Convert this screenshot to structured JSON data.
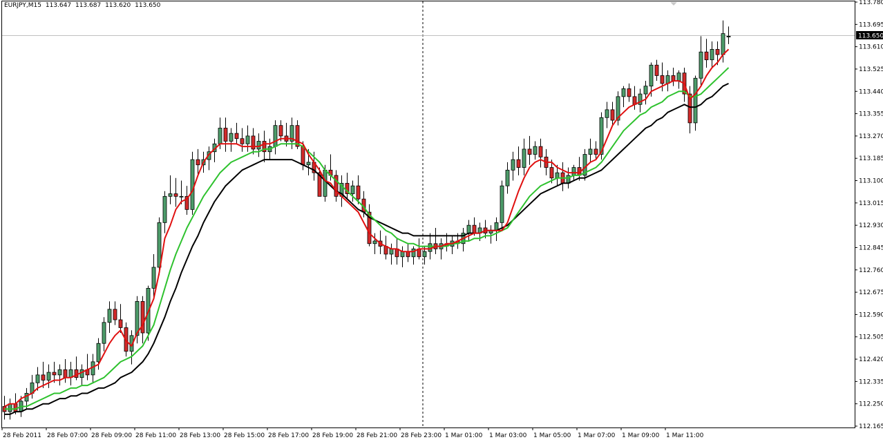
{
  "header": {
    "symbol": "EURJPY,M15",
    "open": "113.647",
    "high": "113.687",
    "low": "113.620",
    "close": "113.650"
  },
  "current_price_label": "113.650",
  "colors": {
    "background": "#ffffff",
    "frame": "#000000",
    "bull_body": "#4d9c6a",
    "bear_body": "#d22a2a",
    "wick": "#000000",
    "ma_fast": "#e01010",
    "ma_mid": "#2ec22e",
    "ma_slow": "#000000",
    "price_line": "#c0c0c0",
    "price_tag_bg": "#000000",
    "price_tag_text": "#ffffff"
  },
  "chart_data": {
    "type": "candlestick",
    "symbol": "EURJPY",
    "timeframe": "M15",
    "ylim": [
      112.165,
      113.78
    ],
    "y_tick_labels": [
      "113.780",
      "113.695",
      "113.610",
      "113.525",
      "113.440",
      "113.355",
      "113.270",
      "113.185",
      "113.100",
      "113.015",
      "112.930",
      "112.845",
      "112.760",
      "112.675",
      "112.590",
      "112.505",
      "112.420",
      "112.335",
      "112.250",
      "112.165"
    ],
    "x_tick_labels": [
      "28 Feb 2011",
      "28 Feb 07:00",
      "28 Feb 09:00",
      "28 Feb 11:00",
      "28 Feb 13:00",
      "28 Feb 15:00",
      "28 Feb 17:00",
      "28 Feb 19:00",
      "28 Feb 21:00",
      "28 Feb 23:00",
      "1 Mar 01:00",
      "1 Mar 03:00",
      "1 Mar 05:00",
      "1 Mar 07:00",
      "1 Mar 09:00",
      "1 Mar 11:00"
    ],
    "bars_per_label": 8,
    "vertical_marker_after_label": "28 Feb 23:00",
    "candles": [
      [
        112.24,
        112.28,
        112.19,
        112.22
      ],
      [
        112.22,
        112.27,
        112.19,
        112.25
      ],
      [
        112.25,
        112.29,
        112.21,
        112.22
      ],
      [
        112.22,
        112.28,
        112.2,
        112.26
      ],
      [
        112.26,
        112.31,
        112.23,
        112.29
      ],
      [
        112.29,
        112.36,
        112.27,
        112.33
      ],
      [
        112.33,
        112.39,
        112.3,
        112.36
      ],
      [
        112.36,
        112.41,
        112.31,
        112.34
      ],
      [
        112.34,
        112.4,
        112.31,
        112.37
      ],
      [
        112.37,
        112.41,
        112.33,
        112.36
      ],
      [
        112.36,
        112.4,
        112.32,
        112.38
      ],
      [
        112.38,
        112.42,
        112.33,
        112.35
      ],
      [
        112.35,
        112.41,
        112.32,
        112.38
      ],
      [
        112.38,
        112.43,
        112.34,
        112.35
      ],
      [
        112.35,
        112.4,
        112.32,
        112.38
      ],
      [
        112.38,
        112.44,
        112.34,
        112.36
      ],
      [
        112.36,
        112.44,
        112.33,
        112.41
      ],
      [
        112.41,
        112.5,
        112.38,
        112.48
      ],
      [
        112.48,
        112.58,
        112.45,
        112.56
      ],
      [
        112.56,
        112.64,
        112.52,
        112.61
      ],
      [
        112.61,
        112.64,
        112.55,
        112.57
      ],
      [
        112.57,
        112.63,
        112.52,
        112.54
      ],
      [
        112.54,
        112.56,
        112.43,
        112.45
      ],
      [
        112.45,
        112.53,
        112.4,
        112.51
      ],
      [
        112.51,
        112.66,
        112.48,
        112.64
      ],
      [
        112.64,
        112.66,
        112.48,
        112.52
      ],
      [
        112.52,
        112.7,
        112.49,
        112.69
      ],
      [
        112.69,
        112.82,
        112.65,
        112.77
      ],
      [
        112.77,
        112.96,
        112.74,
        112.94
      ],
      [
        112.94,
        113.06,
        112.9,
        113.04
      ],
      [
        113.04,
        113.12,
        113.01,
        113.05
      ],
      [
        113.05,
        113.11,
        113.0,
        113.04
      ],
      [
        113.04,
        113.1,
        113.01,
        113.04
      ],
      [
        113.04,
        113.08,
        112.97,
        112.99
      ],
      [
        112.99,
        113.21,
        112.97,
        113.18
      ],
      [
        113.18,
        113.22,
        113.12,
        113.16
      ],
      [
        113.16,
        113.21,
        113.13,
        113.18
      ],
      [
        113.18,
        113.23,
        113.14,
        113.21
      ],
      [
        113.21,
        113.26,
        113.17,
        113.24
      ],
      [
        113.24,
        113.34,
        113.22,
        113.3
      ],
      [
        113.3,
        113.34,
        113.21,
        113.25
      ],
      [
        113.25,
        113.3,
        113.21,
        113.28
      ],
      [
        113.28,
        113.32,
        113.24,
        113.26
      ],
      [
        113.26,
        113.3,
        113.21,
        113.24
      ],
      [
        113.24,
        113.31,
        113.21,
        113.27
      ],
      [
        113.27,
        113.3,
        113.2,
        113.22
      ],
      [
        113.22,
        113.28,
        113.19,
        113.25
      ],
      [
        113.25,
        113.29,
        113.17,
        113.21
      ],
      [
        113.21,
        113.26,
        113.18,
        113.23
      ],
      [
        113.23,
        113.33,
        113.2,
        113.31
      ],
      [
        113.31,
        113.33,
        113.25,
        113.27
      ],
      [
        113.27,
        113.32,
        113.23,
        113.25
      ],
      [
        113.25,
        113.34,
        113.22,
        113.31
      ],
      [
        113.31,
        113.33,
        113.22,
        113.23
      ],
      [
        113.23,
        113.25,
        113.14,
        113.16
      ],
      [
        113.16,
        113.22,
        113.12,
        113.17
      ],
      [
        113.17,
        113.21,
        113.1,
        113.13
      ],
      [
        113.13,
        113.15,
        113.04,
        113.04
      ],
      [
        113.04,
        113.16,
        113.02,
        113.14
      ],
      [
        113.14,
        113.2,
        113.1,
        113.12
      ],
      [
        113.12,
        113.14,
        113.02,
        113.04
      ],
      [
        113.04,
        113.12,
        113.0,
        113.09
      ],
      [
        113.09,
        113.13,
        113.03,
        113.05
      ],
      [
        113.05,
        113.1,
        113.02,
        113.08
      ],
      [
        113.08,
        113.12,
        113.01,
        113.03
      ],
      [
        113.03,
        113.06,
        112.96,
        112.98
      ],
      [
        112.98,
        113.01,
        112.85,
        112.86
      ],
      [
        112.86,
        112.9,
        112.82,
        112.87
      ],
      [
        112.87,
        112.91,
        112.82,
        112.85
      ],
      [
        112.85,
        112.89,
        112.8,
        112.82
      ],
      [
        112.82,
        112.86,
        112.78,
        112.84
      ],
      [
        112.84,
        112.88,
        112.78,
        112.81
      ],
      [
        112.81,
        112.85,
        112.77,
        112.83
      ],
      [
        112.83,
        112.86,
        112.79,
        112.81
      ],
      [
        112.81,
        112.85,
        112.78,
        112.84
      ],
      [
        112.84,
        112.88,
        112.8,
        112.81
      ],
      [
        112.81,
        112.85,
        112.78,
        112.83
      ],
      [
        112.83,
        112.9,
        112.8,
        112.86
      ],
      [
        112.86,
        112.92,
        112.82,
        112.84
      ],
      [
        112.84,
        112.88,
        112.8,
        112.86
      ],
      [
        112.86,
        112.9,
        112.83,
        112.85
      ],
      [
        112.85,
        112.89,
        112.82,
        112.87
      ],
      [
        112.87,
        112.9,
        112.84,
        112.86
      ],
      [
        112.86,
        112.92,
        112.83,
        112.9
      ],
      [
        112.9,
        112.95,
        112.87,
        112.93
      ],
      [
        112.93,
        112.96,
        112.89,
        112.9
      ],
      [
        112.9,
        112.94,
        112.87,
        112.92
      ],
      [
        112.92,
        112.95,
        112.88,
        112.9
      ],
      [
        112.9,
        112.93,
        112.86,
        112.91
      ],
      [
        112.91,
        112.96,
        112.87,
        112.94
      ],
      [
        112.94,
        113.1,
        112.91,
        113.08
      ],
      [
        113.08,
        113.17,
        113.05,
        113.14
      ],
      [
        113.14,
        113.21,
        113.1,
        113.18
      ],
      [
        113.18,
        113.23,
        113.12,
        113.15
      ],
      [
        113.15,
        113.26,
        113.12,
        113.22
      ],
      [
        113.22,
        113.27,
        113.16,
        113.2
      ],
      [
        113.2,
        113.25,
        113.18,
        113.23
      ],
      [
        113.23,
        113.26,
        113.15,
        113.19
      ],
      [
        113.19,
        113.22,
        113.12,
        113.15
      ],
      [
        113.15,
        113.18,
        113.09,
        113.11
      ],
      [
        113.11,
        113.16,
        113.08,
        113.13
      ],
      [
        113.13,
        113.17,
        113.06,
        113.09
      ],
      [
        113.09,
        113.15,
        113.07,
        113.12
      ],
      [
        113.12,
        113.16,
        113.1,
        113.15
      ],
      [
        113.15,
        113.19,
        113.1,
        113.12
      ],
      [
        113.12,
        113.22,
        113.1,
        113.2
      ],
      [
        113.2,
        113.26,
        113.17,
        113.22
      ],
      [
        113.22,
        113.25,
        113.18,
        113.2
      ],
      [
        113.2,
        113.36,
        113.18,
        113.34
      ],
      [
        113.34,
        113.4,
        113.3,
        113.37
      ],
      [
        113.37,
        113.4,
        113.31,
        113.33
      ],
      [
        113.33,
        113.44,
        113.31,
        113.42
      ],
      [
        113.42,
        113.46,
        113.38,
        113.45
      ],
      [
        113.45,
        113.47,
        113.4,
        113.42
      ],
      [
        113.42,
        113.46,
        113.37,
        113.39
      ],
      [
        113.39,
        113.45,
        113.36,
        113.43
      ],
      [
        113.43,
        113.48,
        113.39,
        113.46
      ],
      [
        113.46,
        113.55,
        113.42,
        113.54
      ],
      [
        113.54,
        113.56,
        113.48,
        113.5
      ],
      [
        113.5,
        113.55,
        113.44,
        113.47
      ],
      [
        113.47,
        113.52,
        113.44,
        113.5
      ],
      [
        113.5,
        113.53,
        113.46,
        113.48
      ],
      [
        113.48,
        113.52,
        113.45,
        113.51
      ],
      [
        113.51,
        113.53,
        113.4,
        113.43
      ],
      [
        113.43,
        113.46,
        113.28,
        113.32
      ],
      [
        113.32,
        113.5,
        113.29,
        113.49
      ],
      [
        113.49,
        113.65,
        113.46,
        113.59
      ],
      [
        113.59,
        113.64,
        113.53,
        113.56
      ],
      [
        113.56,
        113.63,
        113.53,
        113.6
      ],
      [
        113.6,
        113.63,
        113.54,
        113.58
      ],
      [
        113.58,
        113.71,
        113.55,
        113.66
      ],
      [
        113.647,
        113.687,
        113.62,
        113.65
      ]
    ],
    "moving_averages": [
      {
        "label": "red",
        "values": [
          112.24,
          112.25,
          112.25,
          112.27,
          112.28,
          112.29,
          112.31,
          112.32,
          112.33,
          112.34,
          112.34,
          112.35,
          112.35,
          112.36,
          112.37,
          112.38,
          112.39,
          112.4,
          112.44,
          112.48,
          112.51,
          112.53,
          112.49,
          112.47,
          112.52,
          112.55,
          112.6,
          112.65,
          112.75,
          112.88,
          112.93,
          112.99,
          113.02,
          113.03,
          113.06,
          113.12,
          113.17,
          113.2,
          113.22,
          113.24,
          113.24,
          113.24,
          113.24,
          113.23,
          113.23,
          113.23,
          113.23,
          113.24,
          113.24,
          113.25,
          113.26,
          113.26,
          113.26,
          113.25,
          113.24,
          113.2,
          113.17,
          113.14,
          113.1,
          113.09,
          113.06,
          113.04,
          113.02,
          113.0,
          112.98,
          112.94,
          112.9,
          112.88,
          112.86,
          112.85,
          112.84,
          112.84,
          112.83,
          112.83,
          112.83,
          112.84,
          112.84,
          112.84,
          112.85,
          112.85,
          112.86,
          112.86,
          112.87,
          112.88,
          112.89,
          112.9,
          112.9,
          112.91,
          112.91,
          112.91,
          112.91,
          112.94,
          113.0,
          113.06,
          113.11,
          113.15,
          113.17,
          113.18,
          113.17,
          113.17,
          113.15,
          113.14,
          113.13,
          113.13,
          113.13,
          113.15,
          113.17,
          113.18,
          113.21,
          113.26,
          113.31,
          113.34,
          113.36,
          113.38,
          113.39,
          113.4,
          113.41,
          113.44,
          113.45,
          113.46,
          113.47,
          113.48,
          113.48,
          113.47,
          113.41,
          113.43,
          113.46,
          113.5,
          113.53,
          113.55,
          113.58,
          113.6
        ]
      },
      {
        "label": "green",
        "values": [
          112.23,
          112.23,
          112.23,
          112.24,
          112.24,
          112.25,
          112.26,
          112.27,
          112.28,
          112.29,
          112.29,
          112.3,
          112.31,
          112.31,
          112.32,
          112.32,
          112.33,
          112.34,
          112.35,
          112.37,
          112.39,
          112.41,
          112.42,
          112.43,
          112.45,
          112.47,
          112.51,
          112.55,
          112.62,
          112.69,
          112.76,
          112.82,
          112.87,
          112.92,
          112.96,
          113.0,
          113.04,
          113.07,
          113.1,
          113.13,
          113.15,
          113.17,
          113.18,
          113.19,
          113.2,
          113.21,
          113.21,
          113.22,
          113.22,
          113.23,
          113.24,
          113.24,
          113.24,
          113.24,
          113.23,
          113.21,
          113.19,
          113.17,
          113.14,
          113.12,
          113.1,
          113.08,
          113.06,
          113.04,
          113.02,
          113.0,
          112.97,
          112.95,
          112.93,
          112.91,
          112.9,
          112.88,
          112.87,
          112.86,
          112.86,
          112.85,
          112.85,
          112.85,
          112.85,
          112.85,
          112.85,
          112.86,
          112.86,
          112.87,
          112.87,
          112.88,
          112.88,
          112.89,
          112.89,
          112.9,
          112.91,
          112.92,
          112.95,
          112.98,
          113.01,
          113.04,
          113.06,
          113.08,
          113.09,
          113.1,
          113.11,
          113.11,
          113.11,
          113.12,
          113.12,
          113.13,
          113.14,
          113.15,
          113.17,
          113.2,
          113.23,
          113.26,
          113.29,
          113.31,
          113.33,
          113.35,
          113.36,
          113.38,
          113.39,
          113.4,
          113.42,
          113.43,
          113.44,
          113.44,
          113.42,
          113.42,
          113.43,
          113.45,
          113.47,
          113.49,
          113.51,
          113.53
        ]
      },
      {
        "label": "black",
        "values": [
          112.21,
          112.21,
          112.22,
          112.22,
          112.23,
          112.23,
          112.24,
          112.25,
          112.25,
          112.26,
          112.27,
          112.27,
          112.28,
          112.28,
          112.29,
          112.29,
          112.3,
          112.31,
          112.31,
          112.32,
          112.33,
          112.35,
          112.36,
          112.37,
          112.39,
          112.41,
          112.44,
          112.48,
          112.53,
          112.58,
          112.64,
          112.69,
          112.75,
          112.8,
          112.85,
          112.89,
          112.94,
          112.98,
          113.02,
          113.05,
          113.08,
          113.1,
          113.12,
          113.14,
          113.15,
          113.16,
          113.17,
          113.18,
          113.18,
          113.18,
          113.18,
          113.18,
          113.18,
          113.17,
          113.16,
          113.15,
          113.14,
          113.12,
          113.1,
          113.08,
          113.06,
          113.05,
          113.03,
          113.01,
          112.99,
          112.98,
          112.96,
          112.95,
          112.94,
          112.93,
          112.92,
          112.91,
          112.9,
          112.9,
          112.89,
          112.89,
          112.89,
          112.89,
          112.89,
          112.89,
          112.89,
          112.89,
          112.89,
          112.89,
          112.9,
          112.9,
          112.9,
          112.91,
          112.91,
          112.91,
          112.92,
          112.93,
          112.95,
          112.97,
          112.99,
          113.01,
          113.03,
          113.05,
          113.06,
          113.07,
          113.08,
          113.09,
          113.09,
          113.1,
          113.11,
          113.11,
          113.12,
          113.13,
          113.14,
          113.16,
          113.18,
          113.2,
          113.22,
          113.24,
          113.26,
          113.28,
          113.3,
          113.31,
          113.33,
          113.34,
          113.36,
          113.37,
          113.38,
          113.39,
          113.38,
          113.38,
          113.39,
          113.41,
          113.42,
          113.44,
          113.46,
          113.47
        ]
      }
    ]
  }
}
